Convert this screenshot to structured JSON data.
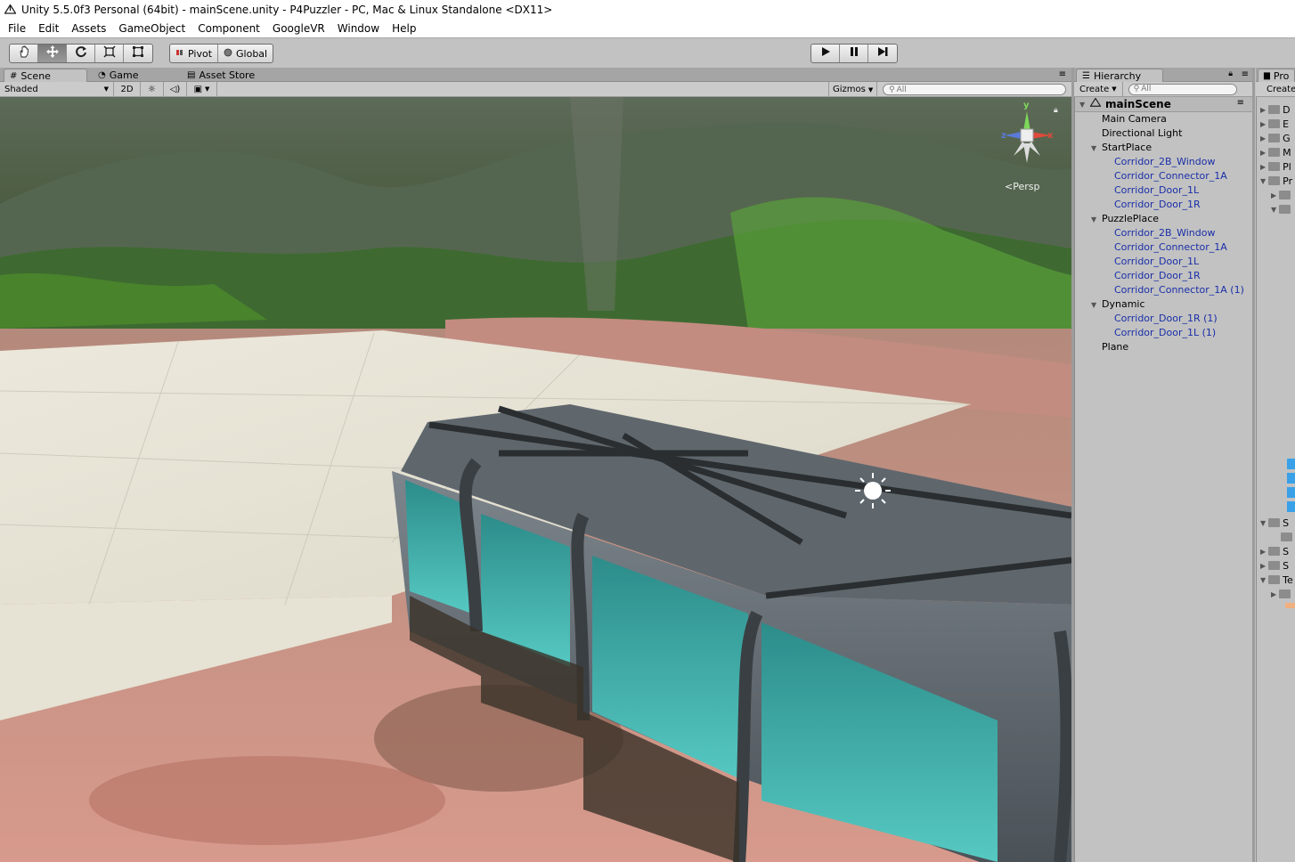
{
  "window": {
    "title": "Unity 5.5.0f3 Personal (64bit) - mainScene.unity - P4Puzzler - PC, Mac & Linux Standalone <DX11>"
  },
  "menu": [
    "File",
    "Edit",
    "Assets",
    "GameObject",
    "Component",
    "GoogleVR",
    "Window",
    "Help"
  ],
  "toolbar": {
    "tools": [
      "hand-icon",
      "move-icon",
      "rotate-icon",
      "scale-icon",
      "rect-icon"
    ],
    "pivot_label": "Pivot",
    "global_label": "Global",
    "play": [
      "play-icon",
      "pause-icon",
      "step-icon"
    ]
  },
  "scene_panel": {
    "tabs": [
      "Scene",
      "Game",
      "Asset Store"
    ],
    "shading_mode": "Shaded",
    "mode_2d": "2D",
    "gizmos_label": "Gizmos",
    "search_placeholder": "All",
    "persp_label": "Persp",
    "gizmo_axes": {
      "y": "y",
      "x": "x",
      "z": "z"
    }
  },
  "hierarchy": {
    "tab": "Hierarchy",
    "create_label": "Create",
    "search_placeholder": "All",
    "scene_name": "mainScene",
    "items": [
      {
        "label": "Main Camera",
        "depth": 1,
        "prefab": false,
        "expandable": false
      },
      {
        "label": "Directional Light",
        "depth": 1,
        "prefab": false,
        "expandable": false
      },
      {
        "label": "StartPlace",
        "depth": 1,
        "prefab": false,
        "expandable": true
      },
      {
        "label": "Corridor_2B_Window",
        "depth": 2,
        "prefab": true,
        "expandable": false
      },
      {
        "label": "Corridor_Connector_1A",
        "depth": 2,
        "prefab": true,
        "expandable": false
      },
      {
        "label": "Corridor_Door_1L",
        "depth": 2,
        "prefab": true,
        "expandable": false
      },
      {
        "label": "Corridor_Door_1R",
        "depth": 2,
        "prefab": true,
        "expandable": false
      },
      {
        "label": "PuzzlePlace",
        "depth": 1,
        "prefab": false,
        "expandable": true
      },
      {
        "label": "Corridor_2B_Window",
        "depth": 2,
        "prefab": true,
        "expandable": false
      },
      {
        "label": "Corridor_Connector_1A",
        "depth": 2,
        "prefab": true,
        "expandable": false
      },
      {
        "label": "Corridor_Door_1L",
        "depth": 2,
        "prefab": true,
        "expandable": false
      },
      {
        "label": "Corridor_Door_1R",
        "depth": 2,
        "prefab": true,
        "expandable": false
      },
      {
        "label": "Corridor_Connector_1A (1)",
        "depth": 2,
        "prefab": true,
        "expandable": false
      },
      {
        "label": "Dynamic",
        "depth": 1,
        "prefab": false,
        "expandable": true
      },
      {
        "label": "Corridor_Door_1R (1)",
        "depth": 2,
        "prefab": true,
        "expandable": false
      },
      {
        "label": "Corridor_Door_1L (1)",
        "depth": 2,
        "prefab": true,
        "expandable": false
      },
      {
        "label": "Plane",
        "depth": 1,
        "prefab": false,
        "expandable": false
      }
    ]
  },
  "project": {
    "tab": "Pro",
    "create_label": "Create",
    "folders": [
      "D",
      "E",
      "G",
      "M",
      "Pl",
      "Pr",
      "",
      "",
      "S",
      "",
      "S",
      "S",
      "Te",
      ""
    ]
  }
}
